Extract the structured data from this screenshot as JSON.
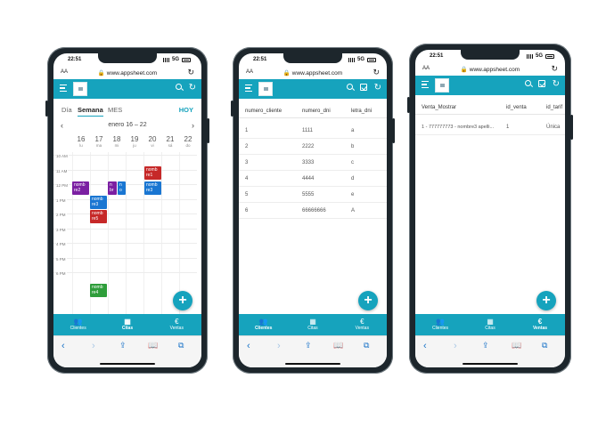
{
  "common": {
    "time": "22:51",
    "network": "5G",
    "url": "www.appsheet.com",
    "aa": "AA",
    "nav": [
      {
        "label": "Clientes",
        "icon": "people-icon"
      },
      {
        "label": "Citas",
        "icon": "calendar-icon"
      },
      {
        "label": "Ventas",
        "icon": "euro-icon"
      }
    ]
  },
  "phone1": {
    "tabs": {
      "dia": "Día",
      "semana": "Semana",
      "mes": "MES",
      "hoy": "HOY"
    },
    "range": "enero 16 – 22",
    "days": [
      {
        "num": "16",
        "dow": "lu"
      },
      {
        "num": "17",
        "dow": "ma"
      },
      {
        "num": "18",
        "dow": "mi"
      },
      {
        "num": "19",
        "dow": "ju"
      },
      {
        "num": "20",
        "dow": "vi"
      },
      {
        "num": "21",
        "dow": "sá"
      },
      {
        "num": "22",
        "dow": "do"
      }
    ],
    "hours": [
      "10 AM",
      "11 AM",
      "12 PM",
      "1 PM",
      "2 PM",
      "3 PM",
      "4 PM",
      "5 PM",
      "6 PM"
    ],
    "events": [
      {
        "l1": "nomb",
        "l2": "re1",
        "color": "#c62828"
      },
      {
        "l1": "nomb",
        "l2": "re2",
        "color": "#7b1fa2"
      },
      {
        "l1": "nomb",
        "l2": "re3",
        "color": "#1976d2"
      },
      {
        "l1": "nomb",
        "l2": "re5",
        "color": "#c62828"
      },
      {
        "l1": "nomb",
        "l2": "re4",
        "color": "#2e9d3a"
      },
      {
        "l1": "n",
        "l2": "br",
        "color": "#7b1fa2"
      },
      {
        "l1": "n",
        "l2": "o",
        "color": "#1976d2"
      },
      {
        "l1": "nomb",
        "l2": "re3",
        "color": "#1976d2"
      }
    ],
    "active_nav": "Citas"
  },
  "phone2": {
    "columns": [
      "numero_cliente",
      "numero_dni",
      "letra_dni"
    ],
    "rows": [
      [
        "1",
        "1111",
        "a"
      ],
      [
        "2",
        "2222",
        "b"
      ],
      [
        "3",
        "3333",
        "c"
      ],
      [
        "4",
        "4444",
        "d"
      ],
      [
        "5",
        "5555",
        "e"
      ],
      [
        "6",
        "66666666",
        "A"
      ]
    ],
    "active_nav": "Clientes"
  },
  "phone3": {
    "columns": [
      "Venta_Mostrar",
      "id_venta",
      "id_tarif"
    ],
    "rows": [
      [
        "1 - 777777773 - nombre3 apelli...",
        "1",
        "Única"
      ]
    ],
    "active_nav": "Ventas"
  },
  "colors": {
    "accent": "#16a3bd",
    "phone_frame": "#1d262c"
  }
}
